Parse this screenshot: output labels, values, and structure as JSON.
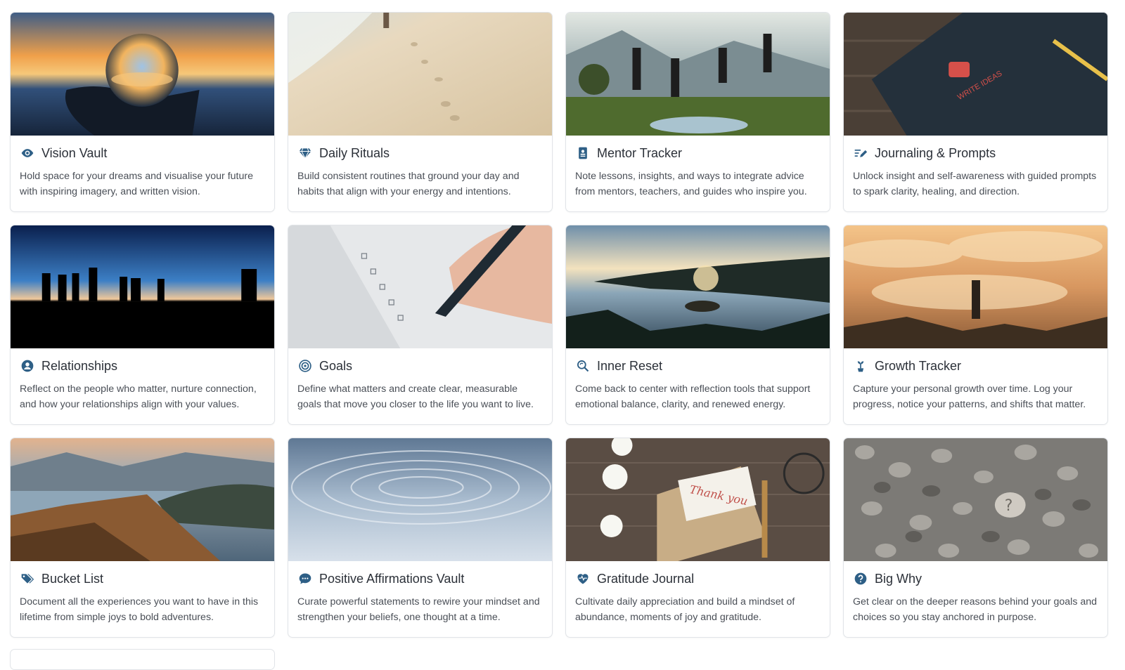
{
  "accent_color": "#2e5f86",
  "cards": [
    {
      "title": "Vision Vault",
      "icon": "eye-icon",
      "desc": "Hold space for your dreams and visualise your future with inspiring imagery, and written vision.",
      "image": "crystal-ball-sunset-image"
    },
    {
      "title": "Daily Rituals",
      "icon": "diamond-icon",
      "desc": "Build consistent routines that ground your day and habits that align with your energy and intentions.",
      "image": "beach-footprints-image"
    },
    {
      "title": "Mentor Tracker",
      "icon": "contact-book-icon",
      "desc": "Note lessons, insights, and ways to integrate advice from mentors, teachers, and guides who inspire you.",
      "image": "people-jumping-mountains-image"
    },
    {
      "title": "Journaling & Prompts",
      "icon": "pen-lines-icon",
      "desc": "Unlock insight and self-awareness with guided prompts to spark clarity, healing, and direction.",
      "image": "notebook-write-ideas-image"
    },
    {
      "title": "Relationships",
      "icon": "user-circle-icon",
      "desc": "Reflect on the people who matter, nurture connection, and how your relationships align with your values.",
      "image": "silhouettes-dusk-image"
    },
    {
      "title": "Goals",
      "icon": "target-icon",
      "desc": "Define what matters and create clear, measurable goals that move you closer to the life you want to live.",
      "image": "checklist-writing-image"
    },
    {
      "title": "Inner Reset",
      "icon": "search-refresh-icon",
      "desc": "Come back to center with reflection tools that support emotional balance, clarity, and renewed energy.",
      "image": "lake-sunset-image"
    },
    {
      "title": "Growth Tracker",
      "icon": "seedling-icon",
      "desc": "Capture your personal growth over time. Log your progress, notice your patterns, and shifts that matter.",
      "image": "hiker-above-clouds-image"
    },
    {
      "title": "Bucket List",
      "icon": "tags-icon",
      "desc": "Document all the experiences you want to have in this lifetime from simple joys to bold adventures.",
      "image": "mountain-ridge-lake-image"
    },
    {
      "title": "Positive Affirmations Vault",
      "icon": "chat-bubble-icon",
      "desc": "Curate powerful statements to rewire your mindset and strengthen your beliefs, one thought at a time.",
      "image": "water-ripples-image"
    },
    {
      "title": "Gratitude Journal",
      "icon": "heart-pulse-icon",
      "desc": "Cultivate daily appreciation and build a mindset of abundance, moments of joy and gratitude.",
      "image": "thank-you-card-image"
    },
    {
      "title": "Big Why",
      "icon": "question-circle-icon",
      "desc": "Get clear on the deeper reasons behind your goals and choices so you stay anchored in purpose.",
      "image": "pebbles-question-image"
    }
  ],
  "image_text": {
    "notebook": "WRITE IDEAS",
    "thank_you": "Thank you"
  }
}
